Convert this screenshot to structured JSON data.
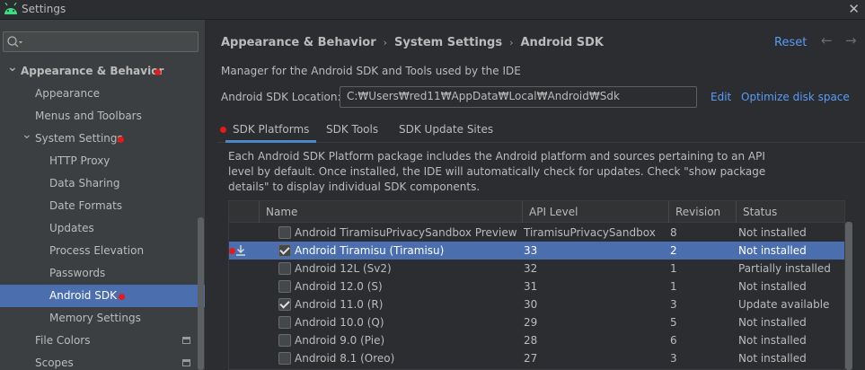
{
  "window": {
    "title": "Settings",
    "close_glyph": "✕",
    "icon": "android-icon"
  },
  "search": {
    "placeholder": "",
    "icon": "search-icon"
  },
  "sidebar": {
    "items": [
      {
        "label": "Appearance & Behavior",
        "level": 0,
        "expanded": true,
        "bold": true,
        "marked": true
      },
      {
        "label": "Appearance",
        "level": 1
      },
      {
        "label": "Menus and Toolbars",
        "level": 1
      },
      {
        "label": "System Settings",
        "level": 1,
        "expanded": true,
        "marked": true
      },
      {
        "label": "HTTP Proxy",
        "level": 2
      },
      {
        "label": "Data Sharing",
        "level": 2
      },
      {
        "label": "Date Formats",
        "level": 2
      },
      {
        "label": "Updates",
        "level": 2
      },
      {
        "label": "Process Elevation",
        "level": 2
      },
      {
        "label": "Passwords",
        "level": 2
      },
      {
        "label": "Android SDK",
        "level": 2,
        "selected": true,
        "marked": true
      },
      {
        "label": "Memory Settings",
        "level": 2
      },
      {
        "label": "File Colors",
        "level": 1,
        "project": true
      },
      {
        "label": "Scopes",
        "level": 1,
        "project": true
      }
    ]
  },
  "header": {
    "breadcrumb": [
      "Appearance & Behavior",
      "System Settings",
      "Android SDK"
    ],
    "separator": "›",
    "reset_label": "Reset",
    "back_glyph": "←",
    "forward_glyph": "→"
  },
  "sdk": {
    "description": "Manager for the Android SDK and Tools used by the IDE",
    "location_label": "Android SDK Location:",
    "location_value": "C:₩Users₩red11₩AppData₩Local₩Android₩Sdk",
    "edit_label": "Edit",
    "optimize_label": "Optimize disk space"
  },
  "tabs": [
    {
      "label": "SDK Platforms",
      "active": true
    },
    {
      "label": "SDK Tools"
    },
    {
      "label": "SDK Update Sites"
    }
  ],
  "panel_description": "Each Android SDK Platform package includes the Android platform and sources pertaining to an API level by default. Once installed, the IDE will automatically check for updates. Check \"show package details\" to display individual SDK components.",
  "table": {
    "columns": [
      "Name",
      "API Level",
      "Revision",
      "Status"
    ],
    "rows": [
      {
        "name": "Android TiramisuPrivacySandbox Preview",
        "api": "TiramisuPrivacySandbox",
        "revision": "8",
        "status": "Not installed",
        "checked": false
      },
      {
        "name": "Android Tiramisu (Tiramisu)",
        "api": "33",
        "revision": "2",
        "status": "Not installed",
        "checked": true,
        "selected": true,
        "download": true
      },
      {
        "name": "Android 12L (Sv2)",
        "api": "32",
        "revision": "1",
        "status": "Partially installed",
        "checked": false
      },
      {
        "name": "Android 12.0 (S)",
        "api": "31",
        "revision": "1",
        "status": "Not installed",
        "checked": false
      },
      {
        "name": "Android 11.0 (R)",
        "api": "30",
        "revision": "3",
        "status": "Update available",
        "checked": true
      },
      {
        "name": "Android 10.0 (Q)",
        "api": "29",
        "revision": "5",
        "status": "Not installed",
        "checked": false
      },
      {
        "name": "Android 9.0 (Pie)",
        "api": "28",
        "revision": "6",
        "status": "Not installed",
        "checked": false
      },
      {
        "name": "Android 8.1 (Oreo)",
        "api": "27",
        "revision": "3",
        "status": "Not installed",
        "checked": false
      }
    ]
  },
  "colors": {
    "accent": "#589df6",
    "selection": "#4b6eaf",
    "marker": "#e31b1b"
  }
}
